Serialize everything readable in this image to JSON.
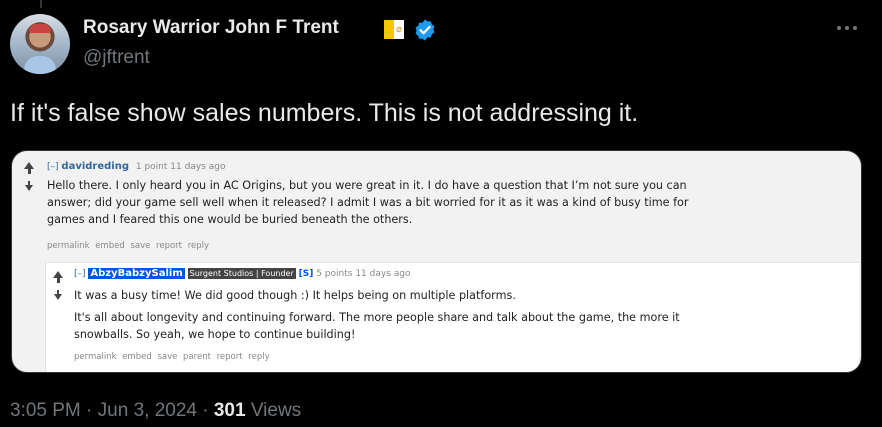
{
  "tweet": {
    "display_name": "Rosary Warrior John F Trent",
    "handle": "@jftrent",
    "text": "If it's false show sales numbers. This is not addressing it.",
    "time": "3:05 PM",
    "date": "Jun 3, 2024",
    "views_count": "301",
    "views_label": "Views",
    "separator": "·",
    "more_icon": "more-icon",
    "verified_icon": "verified-icon",
    "flag_icon": "vatican-flag-icon"
  },
  "screenshot": {
    "parent_comment": {
      "toggle": "[–]",
      "author": "davidreding",
      "points": "1 point",
      "age": "11 days ago",
      "lines": [
        "Hello there. I only heard you in AC Origins, but you were great in it. I do have a question that I’m not sure you can",
        "answer; did your game sell well when it released? I admit I was a bit worried for it as it was a kind of busy time for",
        "games and I feared this one would be buried beneath the others."
      ],
      "actions": [
        "permalink",
        "embed",
        "save",
        "report",
        "reply"
      ]
    },
    "child_comment": {
      "toggle": "[–]",
      "author": "AbzyBabzySalim",
      "flair": "Surgent Studios | Founder",
      "sub_tag": "[S]",
      "points": "5 points",
      "age": "11 days ago",
      "lines": [
        "It was a busy time! We did good though :) It helps being on multiple platforms.",
        "It's all about longevity and continuing forward. The more people share and talk about the game, the more it",
        "snowballs. So yeah, we hope to continue building!"
      ],
      "actions": [
        "permalink",
        "embed",
        "save",
        "parent",
        "report",
        "reply"
      ]
    }
  },
  "colors": {
    "background": "#000000",
    "text_primary": "#e7e9ea",
    "text_secondary": "#71767b",
    "verified": "#1d9bf0",
    "reddit_link": "#336699",
    "reddit_highlight": "#0055df"
  }
}
